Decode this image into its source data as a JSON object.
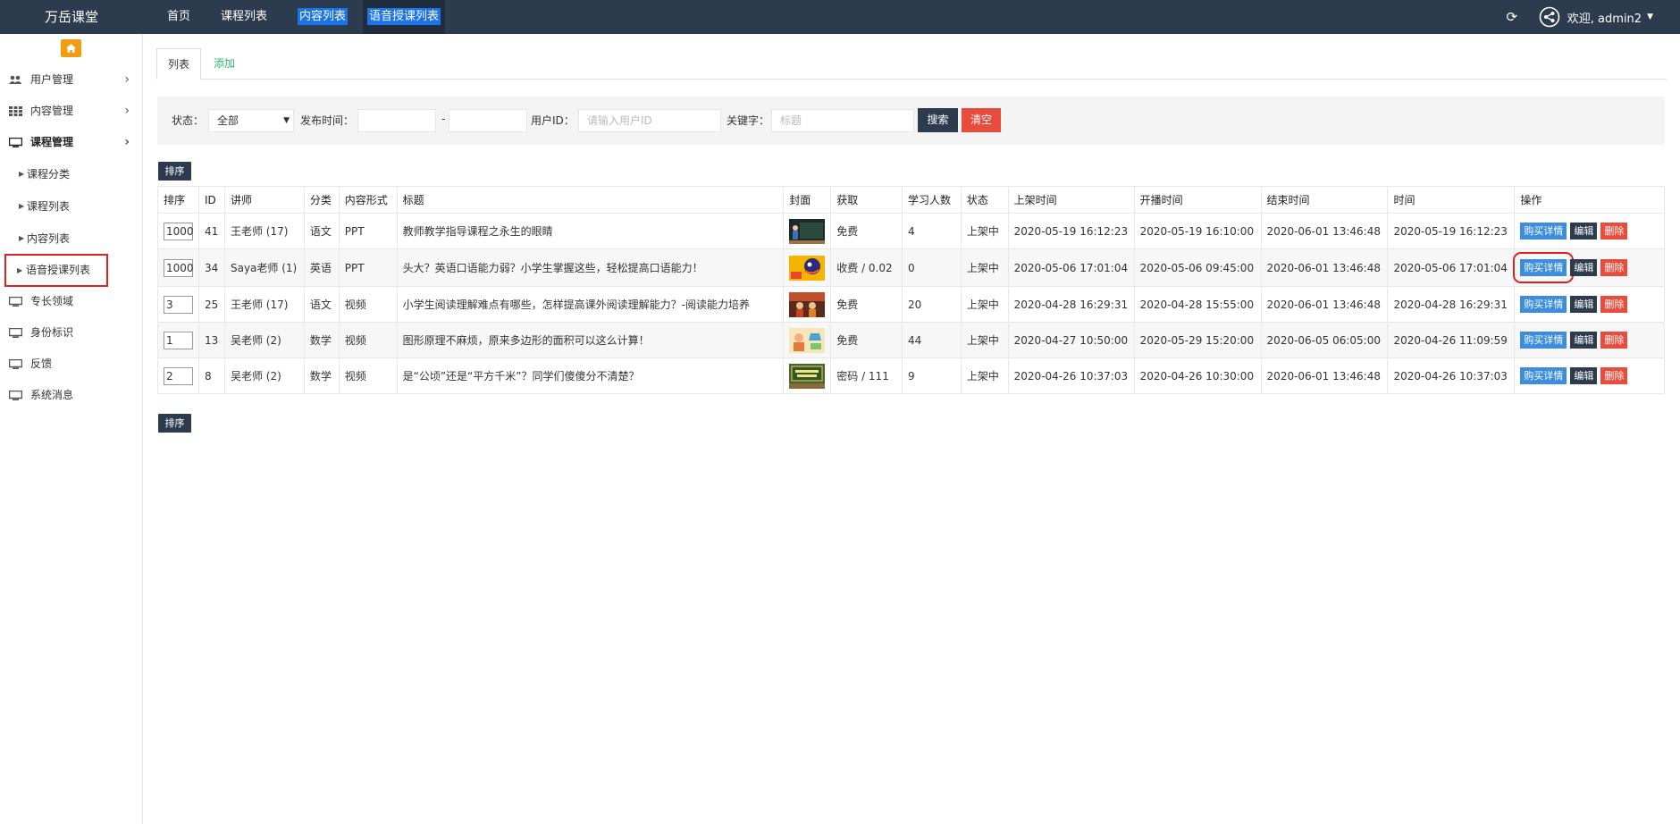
{
  "brand": "万岳课堂",
  "topnav": [
    "首页",
    "课程列表",
    "内容列表",
    "语音授课列表"
  ],
  "topbar": {
    "welcome": "欢迎, admin2"
  },
  "sidebar": {
    "items": [
      {
        "label": "用户管理",
        "icon": "users-icon"
      },
      {
        "label": "内容管理",
        "icon": "grid-icon"
      },
      {
        "label": "课程管理",
        "icon": "monitor-icon"
      }
    ],
    "sub_items": [
      "课程分类",
      "课程列表",
      "内容列表",
      "语音授课列表"
    ],
    "bottom_items": [
      "专长领域",
      "身份标识",
      "反馈",
      "系统消息"
    ]
  },
  "tabs": {
    "list": "列表",
    "add": "添加"
  },
  "filter": {
    "status_label": "状态：",
    "status_value": "全部",
    "time_label": "发布时间：",
    "time_sep": "-",
    "userid_label": "用户ID：",
    "userid_placeholder": "请输入用户ID",
    "keyword_label": "关键字：",
    "keyword_placeholder": "标题",
    "search": "搜索",
    "clear": "清空"
  },
  "sort_button": "排序",
  "table": {
    "headers": [
      "排序",
      "ID",
      "讲师",
      "分类",
      "内容形式",
      "标题",
      "封面",
      "获取",
      "学习人数",
      "状态",
      "上架时间",
      "开播时间",
      "结束时间",
      "时间",
      "操作"
    ],
    "ops": {
      "buy": "购买详情",
      "edit": "编辑",
      "del": "删除"
    },
    "rows": [
      {
        "sort": "1000",
        "id": "41",
        "teacher": "王老师 (17)",
        "cat": "语文",
        "form": "PPT",
        "title": "教师教学指导课程之永生的眼睛",
        "get": "免费",
        "learners": "4",
        "status": "上架中",
        "t1": "2020-05-19 16:12:23",
        "t2": "2020-05-19 16:10:00",
        "t3": "2020-06-01 13:46:48",
        "t4": "2020-05-19 16:12:23"
      },
      {
        "sort": "1000",
        "id": "34",
        "teacher": "Saya老师 (1)",
        "cat": "英语",
        "form": "PPT",
        "title": "头大？英语口语能力弱？小学生掌握这些，轻松提高口语能力！",
        "get": "收费 / 0.02",
        "learners": "0",
        "status": "上架中",
        "t1": "2020-05-06 17:01:04",
        "t2": "2020-05-06 09:45:00",
        "t3": "2020-06-01 13:46:48",
        "t4": "2020-05-06 17:01:04"
      },
      {
        "sort": "3",
        "id": "25",
        "teacher": "王老师 (17)",
        "cat": "语文",
        "form": "视频",
        "title": "小学生阅读理解难点有哪些，怎样提高课外阅读理解能力？-阅读能力培养",
        "get": "免费",
        "learners": "20",
        "status": "上架中",
        "t1": "2020-04-28 16:29:31",
        "t2": "2020-04-28 15:55:00",
        "t3": "2020-06-01 13:46:48",
        "t4": "2020-04-28 16:29:31"
      },
      {
        "sort": "1",
        "id": "13",
        "teacher": "吴老师 (2)",
        "cat": "数学",
        "form": "视频",
        "title": "图形原理不麻烦，原来多边形的面积可以这么计算！",
        "get": "免费",
        "learners": "44",
        "status": "上架中",
        "t1": "2020-04-27 10:50:00",
        "t2": "2020-05-29 15:20:00",
        "t3": "2020-06-05 06:05:00",
        "t4": "2020-04-26 11:09:59"
      },
      {
        "sort": "2",
        "id": "8",
        "teacher": "吴老师 (2)",
        "cat": "数学",
        "form": "视频",
        "title": "是“公顷”还是“平方千米”？同学们傻傻分不清楚？",
        "get": "密码 / 111",
        "learners": "9",
        "status": "上架中",
        "t1": "2020-04-26 10:37:03",
        "t2": "2020-04-26 10:30:00",
        "t3": "2020-06-01 13:46:48",
        "t4": "2020-04-26 10:37:03"
      }
    ]
  }
}
